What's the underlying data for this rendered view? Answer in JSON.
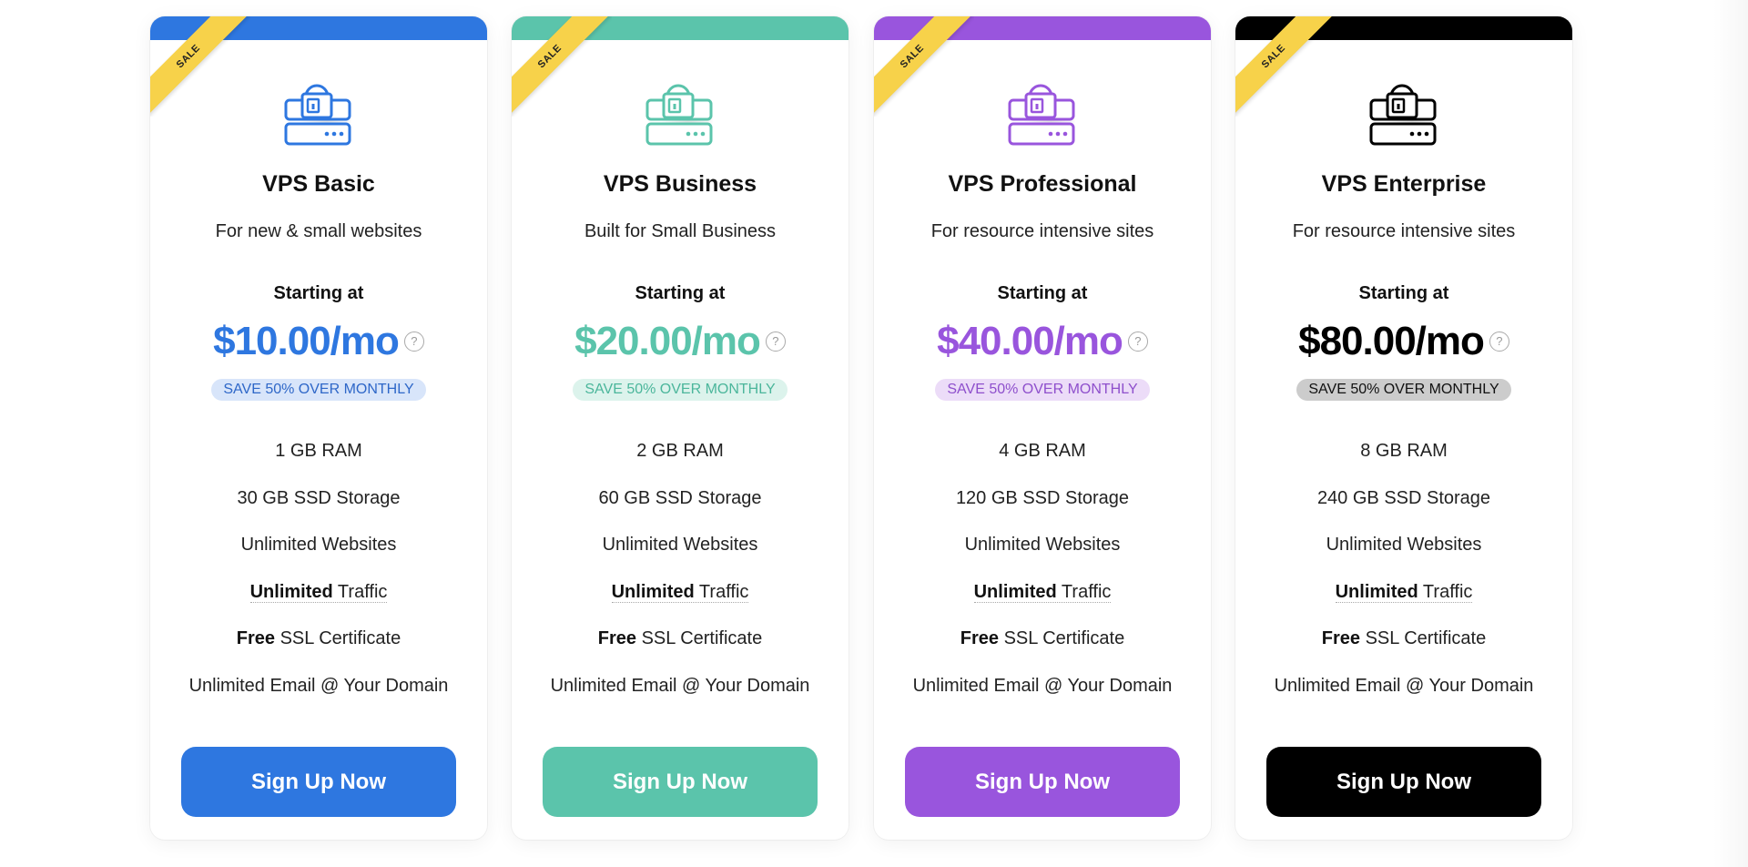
{
  "plans": [
    {
      "ribbon": "SALE",
      "title": "VPS Basic",
      "description": "For new & small websites",
      "starting_label": "Starting at",
      "price": "$10.00/mo",
      "help_icon": "?",
      "save_badge": "SAVE 50% OVER MONTHLY",
      "features": {
        "ram": "1 GB RAM",
        "storage": "30 GB SSD Storage",
        "websites": "Unlimited Websites",
        "traffic_bold": "Unlimited",
        "traffic_rest": " Traffic",
        "ssl_bold": "Free",
        "ssl_rest": " SSL Certificate",
        "email": "Unlimited Email @ Your Domain"
      },
      "button": "Sign Up Now",
      "accent": "#2e77e0",
      "badge_bg": "#d8e5fa",
      "badge_fg": "#2e67c8"
    },
    {
      "ribbon": "SALE",
      "title": "VPS Business",
      "description": "Built for Small Business",
      "starting_label": "Starting at",
      "price": "$20.00/mo",
      "help_icon": "?",
      "save_badge": "SAVE 50% OVER MONTHLY",
      "features": {
        "ram": "2 GB RAM",
        "storage": "60 GB SSD Storage",
        "websites": "Unlimited Websites",
        "traffic_bold": "Unlimited",
        "traffic_rest": " Traffic",
        "ssl_bold": "Free",
        "ssl_rest": " SSL Certificate",
        "email": "Unlimited Email @ Your Domain"
      },
      "button": "Sign Up Now",
      "accent": "#5bc4ab",
      "badge_bg": "#dcf3ec",
      "badge_fg": "#4bb69b"
    },
    {
      "ribbon": "SALE",
      "title": "VPS Professional",
      "description": "For resource intensive sites",
      "starting_label": "Starting at",
      "price": "$40.00/mo",
      "help_icon": "?",
      "save_badge": "SAVE 50% OVER MONTHLY",
      "features": {
        "ram": "4 GB RAM",
        "storage": "120 GB SSD Storage",
        "websites": "Unlimited Websites",
        "traffic_bold": "Unlimited",
        "traffic_rest": " Traffic",
        "ssl_bold": "Free",
        "ssl_rest": " SSL Certificate",
        "email": "Unlimited Email @ Your Domain"
      },
      "button": "Sign Up Now",
      "accent": "#9955dd",
      "badge_bg": "#ecdcf8",
      "badge_fg": "#8e4fcc"
    },
    {
      "ribbon": "SALE",
      "title": "VPS Enterprise",
      "description": "For resource intensive sites",
      "starting_label": "Starting at",
      "price": "$80.00/mo",
      "help_icon": "?",
      "save_badge": "SAVE 50% OVER MONTHLY",
      "features": {
        "ram": "8 GB RAM",
        "storage": "240 GB SSD Storage",
        "websites": "Unlimited Websites",
        "traffic_bold": "Unlimited",
        "traffic_rest": " Traffic",
        "ssl_bold": "Free",
        "ssl_rest": " SSL Certificate",
        "email": "Unlimited Email @ Your Domain"
      },
      "button": "Sign Up Now",
      "accent": "#000000",
      "badge_bg": "#cccccc",
      "badge_fg": "#111111"
    }
  ]
}
